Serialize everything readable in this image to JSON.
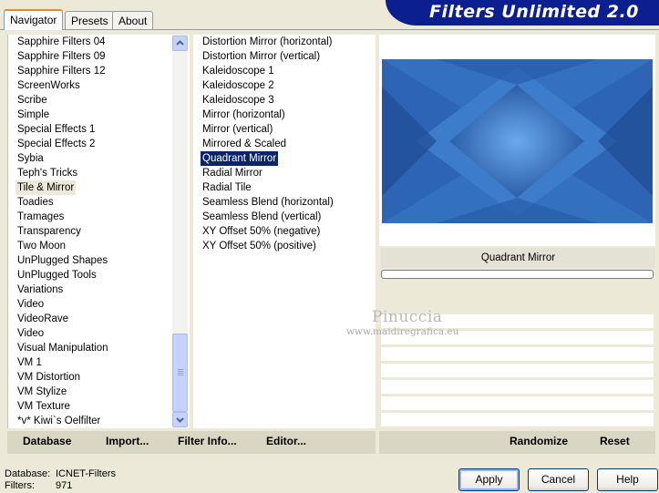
{
  "tabs": [
    "Navigator",
    "Presets",
    "About"
  ],
  "title": "Filters Unlimited 2.0",
  "categories": [
    "Sapphire Filters 04",
    "Sapphire Filters 09",
    "Sapphire Filters 12",
    "ScreenWorks",
    "Scribe",
    "Simple",
    "Special Effects 1",
    "Special Effects 2",
    "Sybia",
    "Teph's Tricks",
    "Tile & Mirror",
    "Toadies",
    "Tramages",
    "Transparency",
    "Two Moon",
    "UnPlugged Shapes",
    "UnPlugged Tools",
    "Variations",
    "Video",
    "VideoRave",
    "Video",
    "Visual Manipulation",
    "VM 1",
    "VM Distortion",
    "VM Stylize",
    "VM Texture",
    "*v* Kiwi`s Oelfilter"
  ],
  "selected_category": "Tile & Mirror",
  "filters": [
    "Distortion Mirror (horizontal)",
    "Distortion Mirror (vertical)",
    "Kaleidoscope 1",
    "Kaleidoscope 2",
    "Kaleidoscope 3",
    "Mirror (horizontal)",
    "Mirror (vertical)",
    "Mirrored & Scaled",
    "Quadrant Mirror",
    "Radial Mirror",
    "Radial Tile",
    "Seamless Blend (horizontal)",
    "Seamless Blend (vertical)",
    "XY Offset 50% (negative)",
    "XY Offset 50% (positive)"
  ],
  "selected_filter": "Quadrant Mirror",
  "preview_filter_name": "Quadrant Mirror",
  "watermark": {
    "name": "Pinuccia",
    "url": "www.maidiregrafica.eu"
  },
  "left_bar": {
    "database_label": "Database",
    "import_label": "Import...",
    "filter_info_label": "Filter Info...",
    "editor_label": "Editor..."
  },
  "right_bar": {
    "randomize_label": "Randomize",
    "reset_label": "Reset"
  },
  "status": {
    "database_label": "Database:",
    "database_value": "ICNET-Filters",
    "filters_label": "Filters:",
    "filters_value": "971"
  },
  "buttons": {
    "apply": "Apply",
    "cancel": "Cancel",
    "help": "Help"
  },
  "colors": {
    "title_bar": "#0c1f91",
    "selection_blue": "#0a246a",
    "preview_blue": "#3a79c6"
  }
}
